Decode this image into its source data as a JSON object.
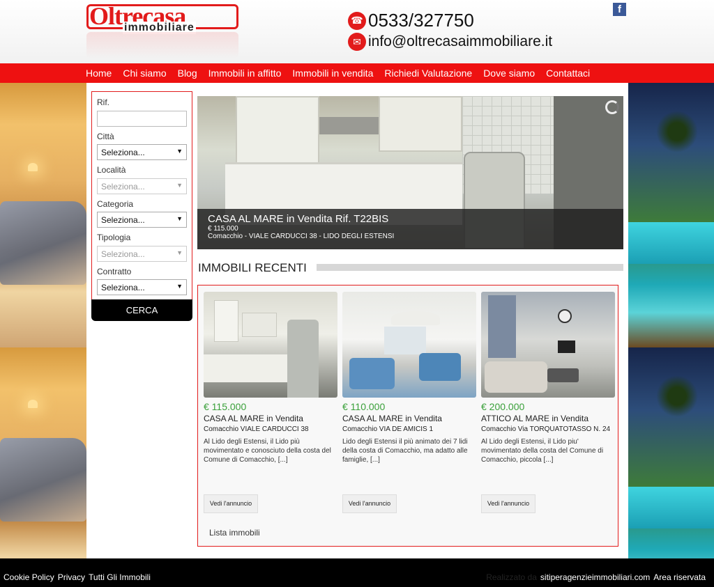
{
  "header": {
    "logo_main": "Oltrecasa",
    "logo_sub": "immobiliare",
    "phone": "0533/327750",
    "email": "info@oltrecasaimmobiliare.it",
    "facebook": "f"
  },
  "nav": {
    "items": [
      "Home",
      "Chi siamo",
      "Blog",
      "Immobili in affitto",
      "Immobili in vendita",
      "Richiedi Valutazione",
      "Dove siamo",
      "Contattaci"
    ]
  },
  "search": {
    "rif_label": "Rif.",
    "citta_label": "Città",
    "citta_value": "Seleziona...",
    "localita_label": "Località",
    "localita_value": "Seleziona...",
    "categoria_label": "Categoria",
    "categoria_value": "Seleziona...",
    "tipologia_label": "Tipologia",
    "tipologia_value": "Seleziona...",
    "contratto_label": "Contratto",
    "contratto_value": "Seleziona...",
    "button": "CERCA"
  },
  "hero": {
    "title": "CASA AL MARE in Vendita Rif. T22BIS",
    "price": "€ 115.000",
    "location": "Comacchio - VIALE CARDUCCI 38 - LIDO DEGLI ESTENSI"
  },
  "recent": {
    "title": "IMMOBILI RECENTI",
    "list_link": "Lista immobili",
    "cards": [
      {
        "price": "€ 115.000",
        "title": "CASA AL MARE in Vendita",
        "location": "Comacchio VIALE CARDUCCI 38",
        "desc": "Al Lido degli Estensi, il Lido più movimentato e conosciuto della costa del Comune di Comacchio, [...]",
        "button": "Vedi l'annuncio"
      },
      {
        "price": "€ 110.000",
        "title": "CASA AL MARE in Vendita",
        "location": "Comacchio VIA DE AMICIS 1",
        "desc": "Lido degli Estensi il più animato dei 7 lidi della costa di Comacchio, ma adatto alle famiglie, [...]",
        "button": "Vedi l'annuncio"
      },
      {
        "price": "€ 200.000",
        "title": "ATTICO AL MARE in Vendita",
        "location": "Comacchio Via TORQUATOTASSO N. 24",
        "desc": "Al Lido degli Estensi, il Lido piu' movimentato della costa del Comune di Comacchio, piccola [...]",
        "button": "Vedi l'annuncio"
      }
    ]
  },
  "footer": {
    "links": [
      "Cookie Policy",
      "Privacy",
      "Tutti Gli Immobili"
    ],
    "realizzato": "Realizzato da",
    "site": "sitiperagenzieimmobiliari.com",
    "area": "Area riservata"
  },
  "colors": {
    "brand_red": "#ee1111",
    "price_green": "#3aa03a",
    "footer_black": "#000000"
  }
}
